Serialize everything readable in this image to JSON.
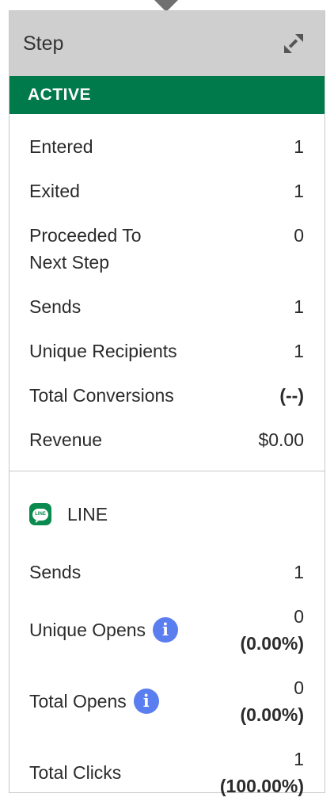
{
  "header": {
    "title": "Step"
  },
  "status": {
    "label": "ACTIVE"
  },
  "stats": [
    {
      "label": "Entered",
      "value": "1"
    },
    {
      "label": "Exited",
      "value": "1"
    },
    {
      "label": "Proceeded To Next Step",
      "value": "0"
    },
    {
      "label": "Sends",
      "value": "1"
    },
    {
      "label": "Unique Recipients",
      "value": "1"
    },
    {
      "label": "Total Conversions",
      "value": "(--)"
    },
    {
      "label": "Revenue",
      "value": "$0.00"
    }
  ],
  "channel": {
    "name": "LINE",
    "icon": "line-app-icon",
    "rows": [
      {
        "label": "Sends",
        "value": "1",
        "percent": ""
      },
      {
        "label": "Unique Opens",
        "value": "0",
        "percent": "(0.00%)"
      },
      {
        "label": "Total Opens",
        "value": "0",
        "percent": "(0.00%)"
      },
      {
        "label": "Total Clicks",
        "value": "1",
        "percent": "(100.00%)"
      }
    ]
  },
  "colors": {
    "active_green": "#007a4b",
    "header_gray": "#cfcfcf",
    "info_blue": "#5a7ef0"
  }
}
